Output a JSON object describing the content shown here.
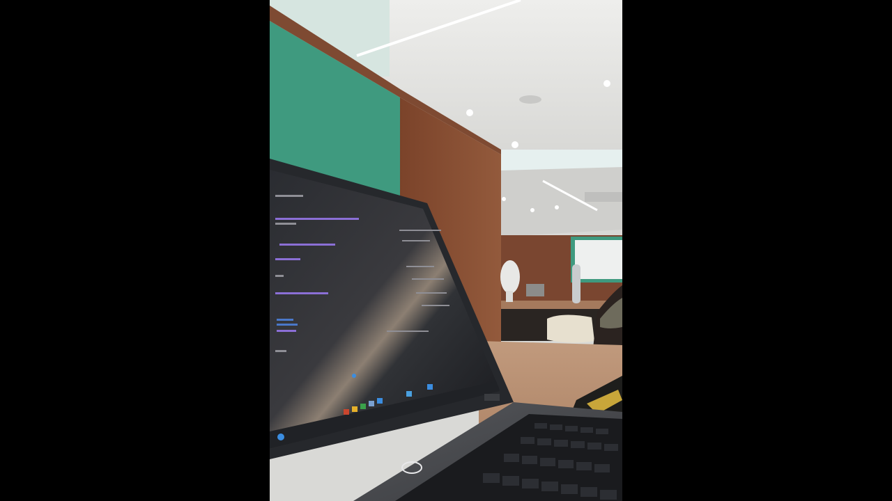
{
  "scene": {
    "kind": "photo",
    "subject": "office-workspace-with-laptop",
    "colors": {
      "letterbox": "#000000",
      "ceiling": "#e4e4e2",
      "ceiling_far": "#d7d7d4",
      "teal_panel": "#3f9a7f",
      "wood_partition": "#8a4f33",
      "wood_dark": "#6d3c25",
      "desk_top": "#b58a6c",
      "laptop_body": "#2b2d31",
      "laptop_screen": "#1d1f24",
      "keyboard": "#1a1b1e",
      "whiteboard": "#eef0ef",
      "code_purple": "#8b6fd6",
      "code_blue": "#4a78c9"
    },
    "icons": [
      "laptop-icon",
      "fan-icon",
      "bottle-icon",
      "light-icon"
    ]
  }
}
